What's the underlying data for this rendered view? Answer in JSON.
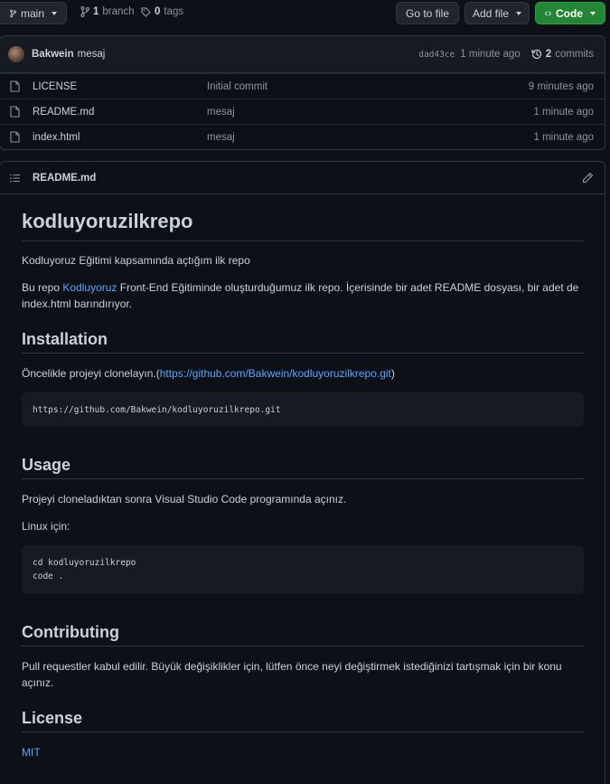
{
  "toolbar": {
    "branch": "main",
    "branches_count": "1",
    "branches_label": "branch",
    "tags_count": "0",
    "tags_label": "tags",
    "goto_file": "Go to file",
    "add_file": "Add file",
    "code": "Code"
  },
  "commit_bar": {
    "author": "Bakwein",
    "message": "mesaj",
    "sha": "dad43ce",
    "time": "1 minute ago",
    "commits_count": "2",
    "commits_label": "commits"
  },
  "files": [
    {
      "name": "LICENSE",
      "commit": "Initial commit",
      "time": "9 minutes ago"
    },
    {
      "name": "README.md",
      "commit": "mesaj",
      "time": "1 minute ago"
    },
    {
      "name": "index.html",
      "commit": "mesaj",
      "time": "1 minute ago"
    }
  ],
  "readme": {
    "filename": "README.md",
    "title": "kodluyoruzilkrepo",
    "intro": "Kodluyoruz Eğitimi kapsamında açtığım ilk repo",
    "desc_prefix": "Bu repo ",
    "desc_link": "Kodluyoruz",
    "desc_suffix": " Front-End Eğitiminde oluşturduğumuz ilk repo. İçerisinde bir adet README dosyası, bir adet de index.html barındırıyor.",
    "installation": {
      "heading": "Installation",
      "text_prefix": "Öncelikle projeyi clonelayın.(",
      "link": "https://github.com/Bakwein/kodluyoruzilkrepo.git",
      "text_suffix": ")",
      "code": "https://github.com/Bakwein/kodluyoruzilkrepo.git"
    },
    "usage": {
      "heading": "Usage",
      "text": "Projeyi cloneladıktan sonra Visual Studio Code programında açınız.",
      "linux": "Linux için:",
      "code": "cd kodluyoruzilkrepo\ncode ."
    },
    "contributing": {
      "heading": "Contributing",
      "text": "Pull requestler kabul edilir. Büyük değişiklikler için, lütfen önce neyi değiştirmek istediğinizi tartışmak için bir konu açınız."
    },
    "license": {
      "heading": "License",
      "link": "MIT"
    }
  },
  "colors": {
    "background": "#0d1117",
    "border": "#30363d",
    "link": "#58a6ff",
    "code_button": "#238636"
  }
}
